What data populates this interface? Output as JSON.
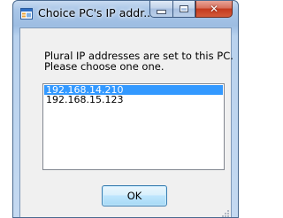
{
  "window": {
    "title": "Choice PC's IP addr...",
    "close_glyph": "✕"
  },
  "dialog": {
    "message": "Plural IP addresses are set to this PC.\nPlease choose one one.",
    "ip_addresses": [
      "192.168.14.210",
      "192.168.15.123"
    ],
    "selected_index": 0,
    "ok_label": "OK"
  },
  "colors": {
    "selection": "#3399ff",
    "close_button": "#c43a1e",
    "title_bar": "#a9c6e8"
  }
}
